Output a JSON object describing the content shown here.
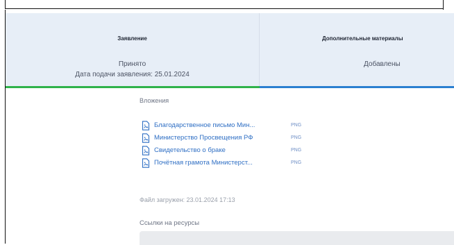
{
  "colors": {
    "status_bg": "#e7eef7",
    "step_done": "#2fb24a",
    "step_active": "#2a7fd0",
    "link": "#2f6fc4"
  },
  "steps": [
    {
      "title": "Заявление",
      "status": "Принято",
      "date_line": "Дата подачи заявления: 25.01.2024"
    },
    {
      "title": "Дополнительные материалы",
      "status": "Добавлены"
    }
  ],
  "attachments_label": "Вложения",
  "attachments": [
    {
      "name": "Благодарственное письмо Мин...",
      "ext": "PNG",
      "icon": "document-icon"
    },
    {
      "name": "Министерство Просвещения РФ",
      "ext": "PNG",
      "icon": "document-icon"
    },
    {
      "name": "Свидетельство о браке",
      "ext": "PNG",
      "icon": "document-icon"
    },
    {
      "name": "Почётная грамота Министерст...",
      "ext": "PNG",
      "icon": "document-icon"
    }
  ],
  "uploaded_text": "Файл загружен: 23.01.2024 17:13",
  "links_label": "Ссылки на ресурсы"
}
